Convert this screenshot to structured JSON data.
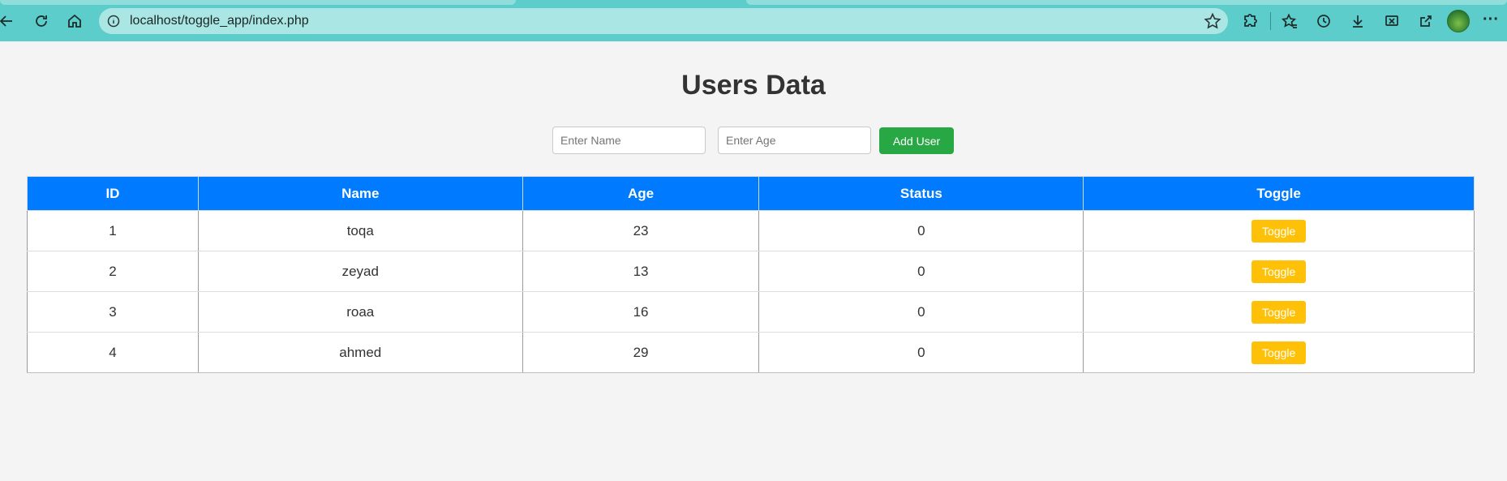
{
  "browser": {
    "url": "localhost/toggle_app/index.php"
  },
  "page": {
    "title": "Users Data"
  },
  "form": {
    "name_placeholder": "Enter Name",
    "age_placeholder": "Enter Age",
    "add_label": "Add User"
  },
  "table": {
    "headers": [
      "ID",
      "Name",
      "Age",
      "Status",
      "Toggle"
    ],
    "rows": [
      {
        "id": "1",
        "name": "toqa",
        "age": "23",
        "status": "0",
        "toggle": "Toggle"
      },
      {
        "id": "2",
        "name": "zeyad",
        "age": "13",
        "status": "0",
        "toggle": "Toggle"
      },
      {
        "id": "3",
        "name": "roaa",
        "age": "16",
        "status": "0",
        "toggle": "Toggle"
      },
      {
        "id": "4",
        "name": "ahmed",
        "age": "29",
        "status": "0",
        "toggle": "Toggle"
      }
    ]
  },
  "colors": {
    "header_bg": "#007bff",
    "add_button": "#28a745",
    "toggle_button": "#ffc107",
    "browser_bar": "#5ccdcb"
  },
  "icons": {
    "back": "arrow-left-icon",
    "refresh": "refresh-icon",
    "home": "home-icon",
    "info": "info-icon",
    "favorite": "star-icon",
    "extensions": "puzzle-icon",
    "favorites": "favorites-icon",
    "history": "history-icon",
    "downloads": "download-icon",
    "screenshot": "screenshot-icon",
    "share": "share-icon",
    "profile": "avatar",
    "more": "more-icon"
  }
}
